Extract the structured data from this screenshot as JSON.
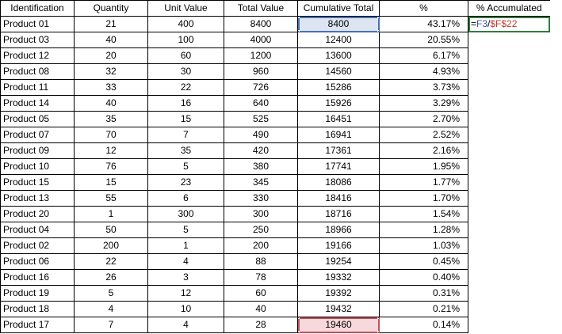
{
  "headers": [
    "Identification",
    "Quantity",
    "Unit Value",
    "Total Value",
    "Cumulative Total",
    "%",
    "% Accumulated"
  ],
  "rows": [
    [
      "Product 01",
      "21",
      "400",
      "8400",
      "8400",
      "43.17%"
    ],
    [
      "Product 03",
      "40",
      "100",
      "4000",
      "12400",
      "20.55%"
    ],
    [
      "Product 12",
      "20",
      "60",
      "1200",
      "13600",
      "6.17%"
    ],
    [
      "Product 08",
      "32",
      "30",
      "960",
      "14560",
      "4.93%"
    ],
    [
      "Product 11",
      "33",
      "22",
      "726",
      "15286",
      "3.73%"
    ],
    [
      "Product 14",
      "40",
      "16",
      "640",
      "15926",
      "3.29%"
    ],
    [
      "Product 05",
      "35",
      "15",
      "525",
      "16451",
      "2.70%"
    ],
    [
      "Product 07",
      "70",
      "7",
      "490",
      "16941",
      "2.52%"
    ],
    [
      "Product 09",
      "12",
      "35",
      "420",
      "17361",
      "2.16%"
    ],
    [
      "Product 10",
      "76",
      "5",
      "380",
      "17741",
      "1.95%"
    ],
    [
      "Product 15",
      "15",
      "23",
      "345",
      "18086",
      "1.77%"
    ],
    [
      "Product 13",
      "55",
      "6",
      "330",
      "18416",
      "1.70%"
    ],
    [
      "Product 20",
      "1",
      "300",
      "300",
      "18716",
      "1.54%"
    ],
    [
      "Product 04",
      "50",
      "5",
      "250",
      "18966",
      "1.28%"
    ],
    [
      "Product 02",
      "200",
      "1",
      "200",
      "19166",
      "1.03%"
    ],
    [
      "Product 06",
      "22",
      "4",
      "88",
      "19254",
      "0.45%"
    ],
    [
      "Product 16",
      "26",
      "3",
      "78",
      "19332",
      "0.40%"
    ],
    [
      "Product 19",
      "5",
      "12",
      "60",
      "19392",
      "0.31%"
    ],
    [
      "Product 18",
      "4",
      "10",
      "40",
      "19432",
      "0.21%"
    ],
    [
      "Product 17",
      "7",
      "4",
      "28",
      "19460",
      "0.14%"
    ]
  ],
  "formula": {
    "prefix": "=",
    "ref1": "F3",
    "sep": "/",
    "ref2": "$F$22"
  },
  "colors": {
    "ref1_highlight": "#4a6fb3",
    "ref2_highlight": "#c0505c",
    "active_cell": "#2e7d3c"
  }
}
